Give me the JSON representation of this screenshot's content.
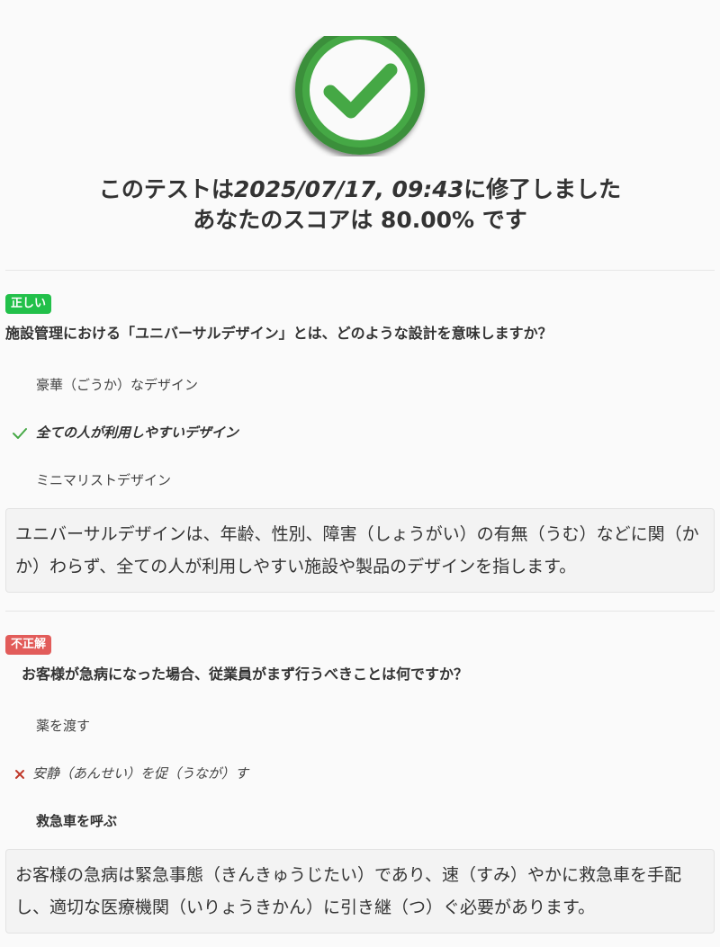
{
  "result": {
    "prefix": "このテストは",
    "timestamp": "2025/07/17, 09:43",
    "suffix": "に修了しました",
    "score_line": "あなたのスコアは 80.00% です"
  },
  "questions": [
    {
      "status": "正しい",
      "text": "施設管理における「ユニバーサルデザイン」とは、どのような設計を意味しますか？",
      "options": [
        "豪華（ごうか）なデザイン",
        "全ての人が利用しやすいデザイン",
        "ミニマリストデザイン"
      ],
      "explanation": "ユニバーサルデザインは、年齢、性別、障害（しょうがい）の有無（うむ）などに関（かか）わらず、全ての人が利用しやすい施設や製品のデザインを指します。"
    },
    {
      "status": "不正解",
      "text": "お客様が急病になった場合、従業員がまず行うべきことは何ですか？",
      "options": [
        "薬を渡す",
        "安静（あんせい）を促（うなが）す",
        "救急車を呼ぶ"
      ],
      "explanation": "お客様の急病は緊急事態（きんきゅうじたい）であり、速（すみ）やかに救急車を手配し、適切な医療機関（いりょうきかん）に引き継（つ）ぐ必要があります。"
    }
  ],
  "colors": {
    "success_green": "#45a845",
    "correct_badge": "#22c04a",
    "wrong_badge": "#e25c5a",
    "wrong_mark": "#c0392b"
  },
  "icons": {
    "hero": "check-circle-icon",
    "correct_mark": "checkmark-icon",
    "wrong_mark": "cross-icon"
  }
}
